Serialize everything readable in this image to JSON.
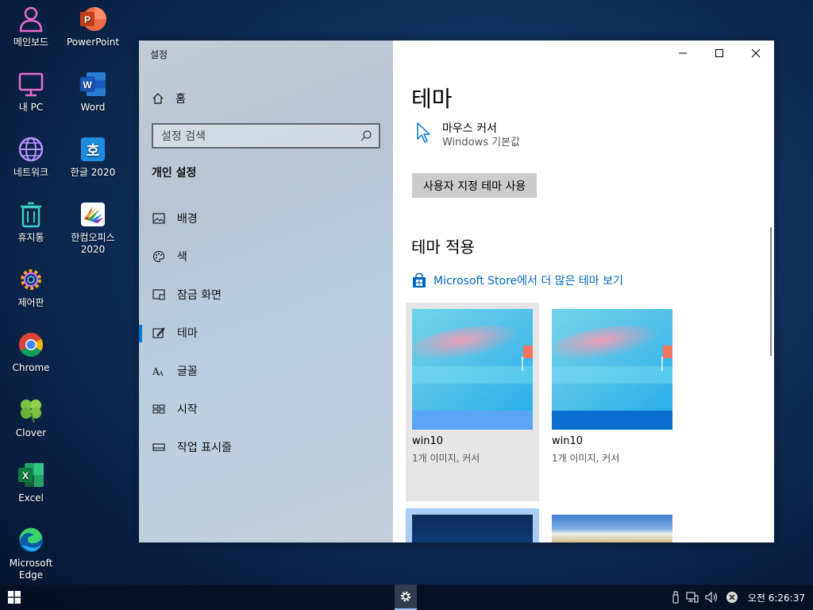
{
  "desktop": {
    "icons": [
      {
        "label": "메인보드",
        "icon": "user-board-icon"
      },
      {
        "label": "PowerPoint",
        "icon": "powerpoint-icon"
      },
      {
        "label": "내 PC",
        "icon": "monitor-icon"
      },
      {
        "label": "Word",
        "icon": "word-icon"
      },
      {
        "label": "네트워크",
        "icon": "globe-icon"
      },
      {
        "label": "한글 2020",
        "icon": "hangul-icon"
      },
      {
        "label": "휴지통",
        "icon": "trash-icon"
      },
      {
        "label": "한컴오피스 2020",
        "icon": "hancom-icon"
      },
      {
        "label": "제어판",
        "icon": "control-panel-icon"
      },
      {
        "label": "Chrome",
        "icon": "chrome-icon"
      },
      {
        "label": "Clover",
        "icon": "clover-icon"
      },
      {
        "label": "Excel",
        "icon": "excel-icon"
      },
      {
        "label": "Microsoft Edge",
        "icon": "edge-icon"
      }
    ]
  },
  "settings": {
    "app_title": "설정",
    "home_label": "홈",
    "search_placeholder": "설정 검색",
    "section_title": "개인 설정",
    "nav": [
      {
        "label": "배경",
        "icon": "picture-icon"
      },
      {
        "label": "색",
        "icon": "palette-icon"
      },
      {
        "label": "잠금 화면",
        "icon": "lock-screen-icon"
      },
      {
        "label": "테마",
        "icon": "theme-icon",
        "active": true
      },
      {
        "label": "글꼴",
        "icon": "font-icon"
      },
      {
        "label": "시작",
        "icon": "start-icon"
      },
      {
        "label": "작업 표시줄",
        "icon": "taskbar-icon"
      }
    ],
    "main": {
      "page_title": "테마",
      "cursor_title": "마우스 커서",
      "cursor_value": "Windows 기본값",
      "custom_theme_button": "사용자 지정 테마 사용",
      "apply_title": "테마 적용",
      "store_link": "Microsoft Store에서 더 많은 테마 보기",
      "themes": [
        {
          "name": "win10",
          "desc": "1개 이미지, 커서",
          "selected": true
        },
        {
          "name": "win10",
          "desc": "1개 이미지, 커서",
          "selected": false
        }
      ]
    }
  },
  "taskbar": {
    "clock": "오전 6:26:37"
  }
}
